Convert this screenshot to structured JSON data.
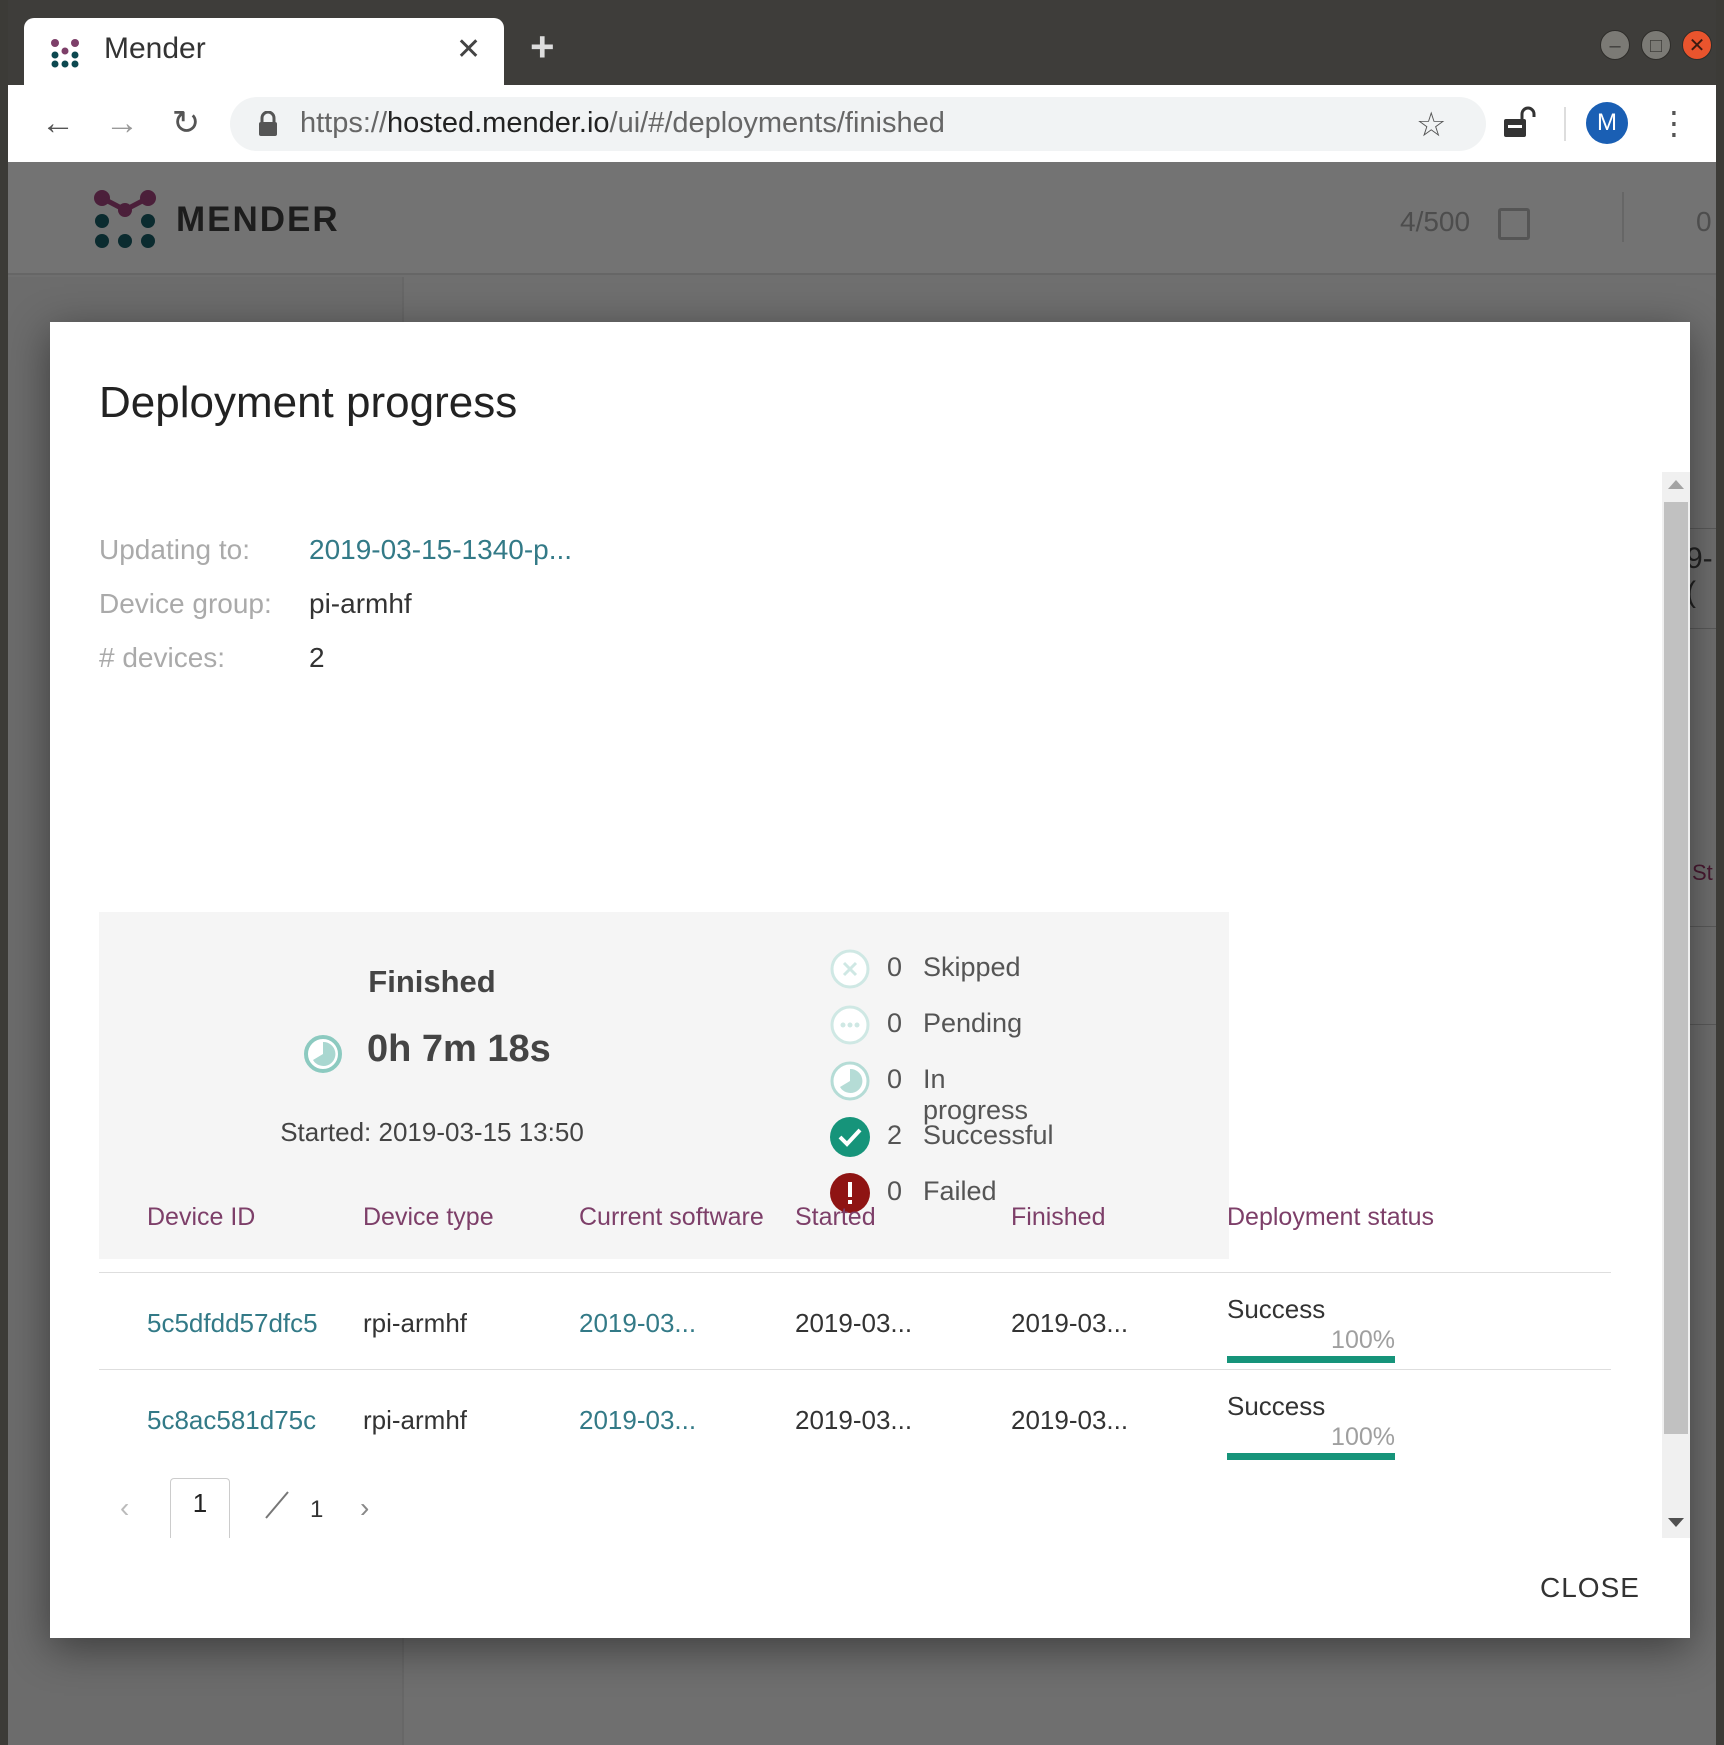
{
  "browser": {
    "tab_title": "Mender",
    "url_scheme": "https://",
    "url_host": "hosted.mender.io",
    "url_path": "/ui/#/deployments/finished",
    "profile_initial": "M"
  },
  "app": {
    "brand": "MENDER",
    "device_count": "4/500",
    "secondary_count": "0",
    "bg_fragment_1": "9-(",
    "bg_fragment_2": "St"
  },
  "dialog": {
    "title": "Deployment progress",
    "info": {
      "updating_to_label": "Updating to:",
      "updating_to_value": "2019-03-15-1340-p...",
      "device_group_label": "Device group:",
      "device_group_value": "pi-armhf",
      "devices_label": "# devices:",
      "devices_value": "2"
    },
    "summary": {
      "state": "Finished",
      "elapsed": "0h 7m 18s",
      "started": "Started: 2019-03-15 13:50",
      "stats": [
        {
          "count": "0",
          "label": "Skipped",
          "icon": "skipped-icon"
        },
        {
          "count": "0",
          "label": "Pending",
          "icon": "pending-icon"
        },
        {
          "count": "0",
          "label": "In progress",
          "icon": "in-progress-icon"
        },
        {
          "count": "2",
          "label": "Successful",
          "icon": "success-icon"
        },
        {
          "count": "0",
          "label": "Failed",
          "icon": "failed-icon"
        }
      ]
    },
    "table": {
      "headers": [
        "Device ID",
        "Device type",
        "Current software",
        "Started",
        "Finished",
        "Deployment status"
      ],
      "rows": [
        {
          "device_id": "5c5dfdd57dfc5",
          "device_type": "rpi-armhf",
          "software": "2019-03...",
          "started": "2019-03...",
          "finished": "2019-03...",
          "status": "Success",
          "progress_label": "100%",
          "progress": 100
        },
        {
          "device_id": "5c8ac581d75c",
          "device_type": "rpi-armhf",
          "software": "2019-03...",
          "started": "2019-03...",
          "finished": "2019-03...",
          "status": "Success",
          "progress_label": "100%",
          "progress": 100
        }
      ]
    },
    "pagination": {
      "prev": "‹",
      "current": "1",
      "total": "1",
      "next": "›"
    },
    "close_label": "CLOSE"
  },
  "colors": {
    "link": "#337a87",
    "header": "#7d3f69",
    "success": "#16947a",
    "failed": "#8f1413"
  }
}
